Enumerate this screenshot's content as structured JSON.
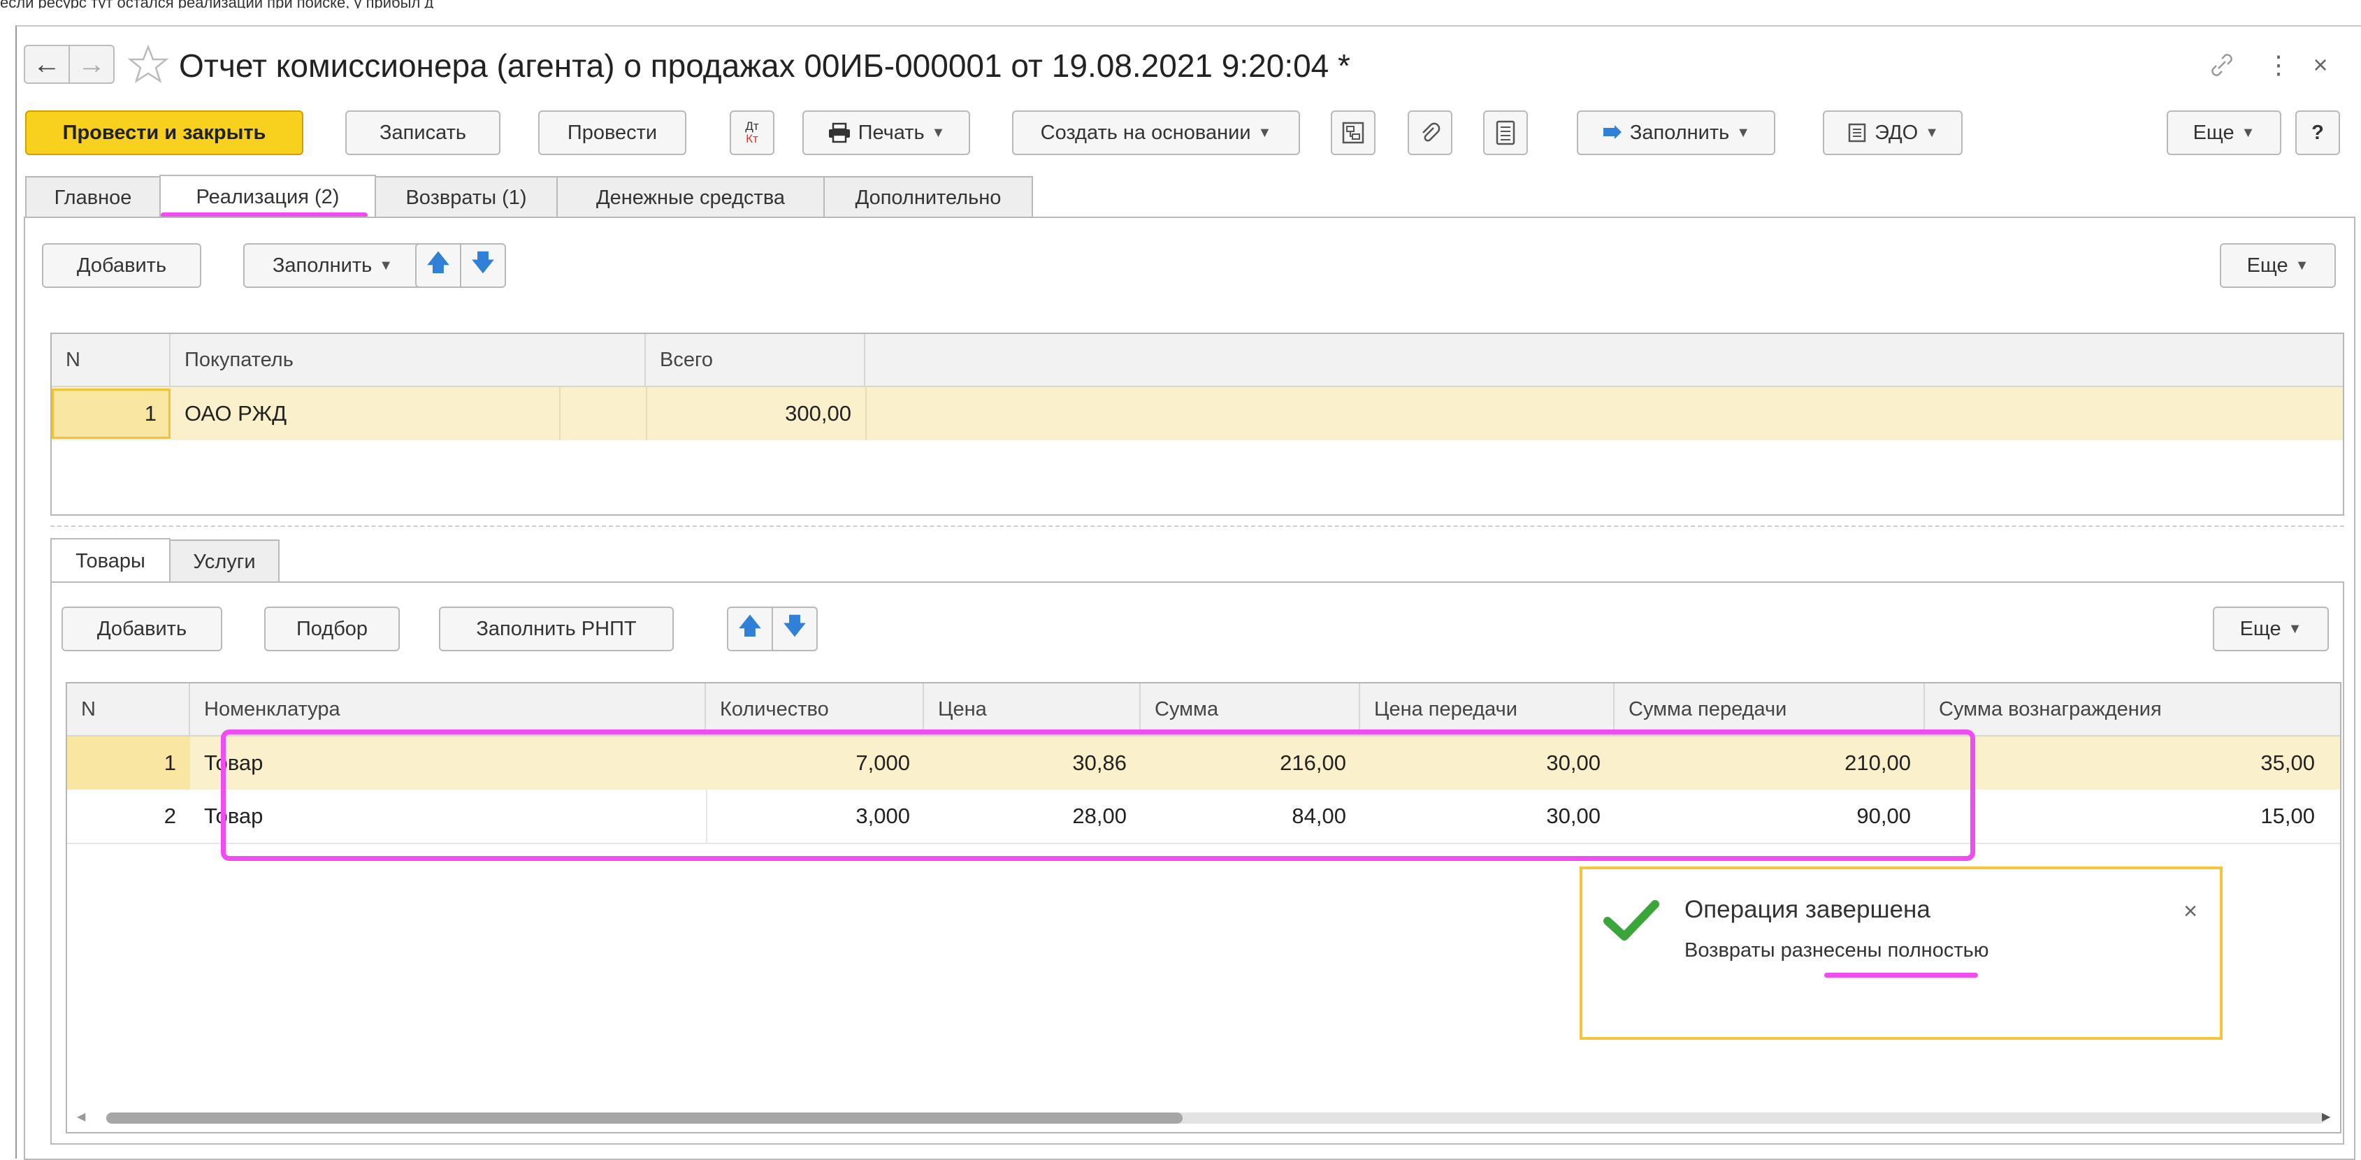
{
  "top_strip_text": "если ресурс тут остался реализации при поиске, у прибыл д",
  "window": {
    "title": "Отчет комиссионера (агента) о продажах 00ИБ-000001 от 19.08.2021 9:20:04 *"
  },
  "toolbar": {
    "post_close": "Провести и закрыть",
    "write": "Записать",
    "post": "Провести",
    "dtkt_top": "Дт",
    "dtkt_bottom": "Кт",
    "print": "Печать",
    "create_based": "Создать на основании",
    "fill": "Заполнить",
    "edo": "ЭДО",
    "more": "Еще",
    "help": "?"
  },
  "tabs": [
    {
      "label": "Главное"
    },
    {
      "label": "Реализация (2)"
    },
    {
      "label": "Возвраты (1)"
    },
    {
      "label": "Денежные средства"
    },
    {
      "label": "Дополнительно"
    }
  ],
  "sales_toolbar": {
    "add": "Добавить",
    "fill": "Заполнить",
    "more": "Еще"
  },
  "sales_table": {
    "columns": [
      "N",
      "Покупатель",
      "Всего"
    ],
    "rows": [
      {
        "n": "1",
        "buyer": "ОАО РЖД",
        "total": "300,00"
      }
    ]
  },
  "subtabs": [
    {
      "label": "Товары"
    },
    {
      "label": "Услуги"
    }
  ],
  "goods_toolbar": {
    "add": "Добавить",
    "select": "Подбор",
    "fill_rnpt": "Заполнить РНПТ",
    "more": "Еще"
  },
  "goods_table": {
    "columns": [
      "N",
      "Номенклатура",
      "Количество",
      "Цена",
      "Сумма",
      "Цена передачи",
      "Сумма передачи",
      "Сумма вознаграждения"
    ],
    "rows": [
      {
        "n": "1",
        "item": "Товар",
        "qty": "7,000",
        "price": "30,86",
        "sum": "216,00",
        "transfer_price": "30,00",
        "transfer_sum": "210,00",
        "reward": "35,00"
      },
      {
        "n": "2",
        "item": "Товар",
        "qty": "3,000",
        "price": "28,00",
        "sum": "84,00",
        "transfer_price": "30,00",
        "transfer_sum": "90,00",
        "reward": "15,00"
      }
    ]
  },
  "notification": {
    "title": "Операция завершена",
    "message": "Возвраты разнесены полностью",
    "close": "×"
  },
  "colors": {
    "accent_yellow": "#f7d11e",
    "highlight_magenta": "#f04cf2",
    "selection_row": "#fbf0cc",
    "success_green": "#3aa63a"
  }
}
